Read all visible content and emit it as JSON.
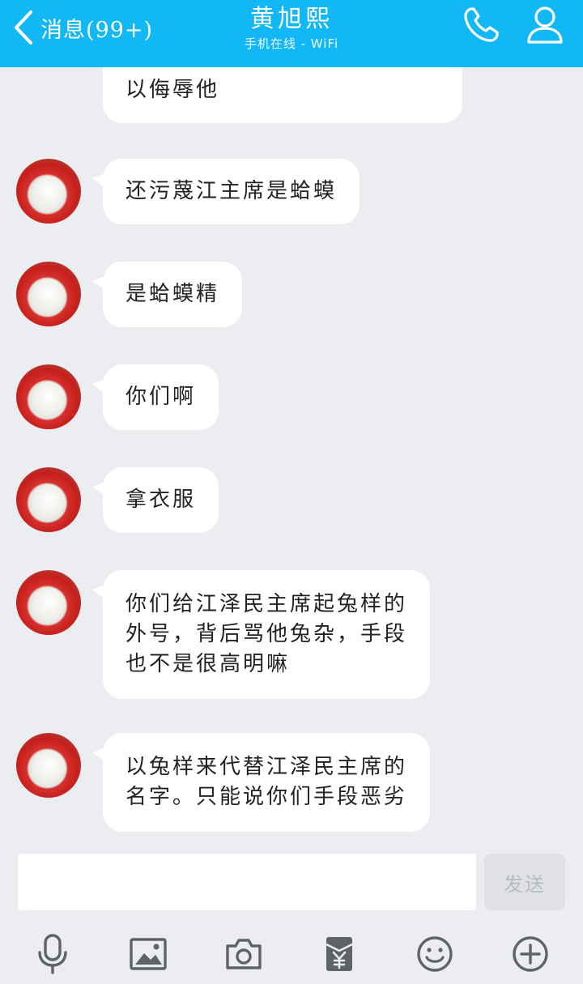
{
  "header": {
    "back_label": "消息(99+)",
    "title": "黄旭熙",
    "subtitle": "手机在线 - WiFi"
  },
  "messages": [
    {
      "text": "以侮辱他",
      "partial": true
    },
    {
      "text": "还污蔑江主席是蛤蟆"
    },
    {
      "text": "是蛤蟆精"
    },
    {
      "text": "你们啊"
    },
    {
      "text": "拿衣服"
    },
    {
      "text": "你们给江泽民主席起兔样的\n外号，背后骂他兔杂，手段\n也不是很高明嘛"
    },
    {
      "text": "以兔样来代替江泽民主席的\n名字。只能说你们手段恶劣"
    }
  ],
  "composer": {
    "input_value": "",
    "send_label": "发送"
  },
  "toolbar": {
    "icons": [
      "microphone-icon",
      "image-icon",
      "camera-icon",
      "red-packet-icon",
      "emoji-icon",
      "plus-icon"
    ]
  },
  "colors": {
    "header_bg": "#12b7f5",
    "chat_bg": "#ebedf0",
    "bubble_bg": "#ffffff",
    "icon_gray": "#5f6368"
  }
}
